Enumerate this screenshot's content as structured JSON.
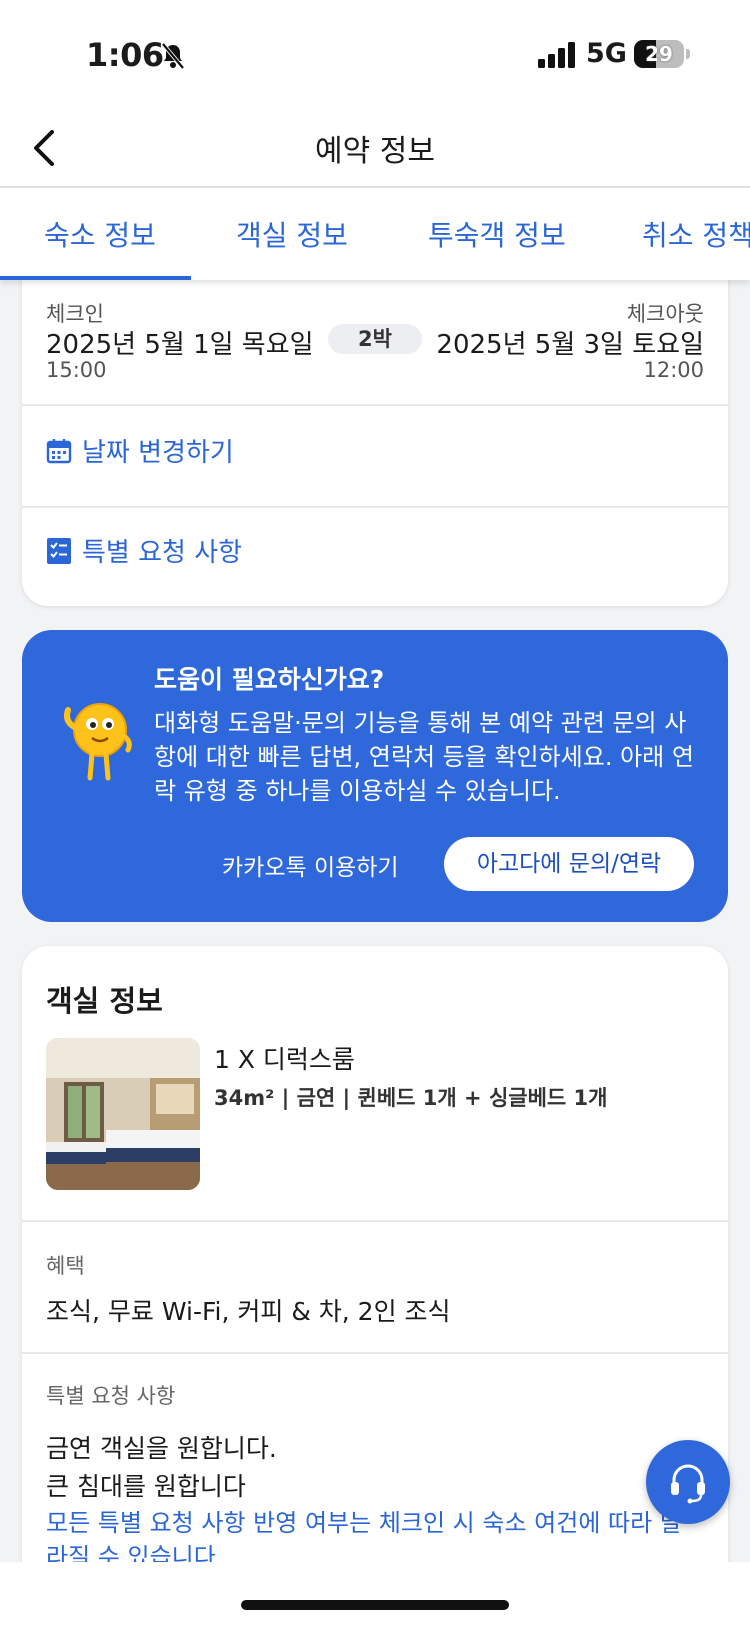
{
  "status_bar": {
    "time": "1:06",
    "network": "5G",
    "battery": "29"
  },
  "nav": {
    "title": "예약 정보"
  },
  "tabs": [
    "숙소 정보",
    "객실 정보",
    "투숙객 정보",
    "취소 정책"
  ],
  "stay": {
    "checkin_label": "체크인",
    "checkin_date": "2025년 5월 1일 목요일",
    "checkin_time": "15:00",
    "nights": "2박",
    "checkout_label": "체크아웃",
    "checkout_date": "2025년 5월 3일 토요일",
    "checkout_time": "12:00",
    "change_date": "날짜 변경하기",
    "special_request": "특별 요청 사항"
  },
  "help": {
    "title": "도움이 필요하신가요?",
    "body": "대화형 도움말·문의 기능을 통해 본 예약 관련 문의 사항에 대한 빠른 답변, 연락처 등을 확인하세요. 아래 연락 유형 중 하나를 이용하실 수 있습니다.",
    "kakao": "카카오톡 이용하기",
    "agoda": "아고다에 문의/연락"
  },
  "room": {
    "heading": "객실 정보",
    "name": "1 X 디럭스룸",
    "specs": "34m² | 금연 | 퀸베드 1개 + 싱글베드 1개",
    "benefits_label": "혜택",
    "benefits": "조식, 무료 Wi-Fi, 커피 & 차, 2인 조식",
    "requests_label": "특별 요청 사항",
    "request_1": "금연 객실을 원합니다.",
    "request_2": "큰 침대를 원합니다",
    "requests_note": "모든 특별 요청 사항 반영 여부는 체크인 시 숙소 여건에 따라 달라질 수 있습니다."
  },
  "colors": {
    "accent": "#2b66d9",
    "help_bg": "#2f68db"
  }
}
